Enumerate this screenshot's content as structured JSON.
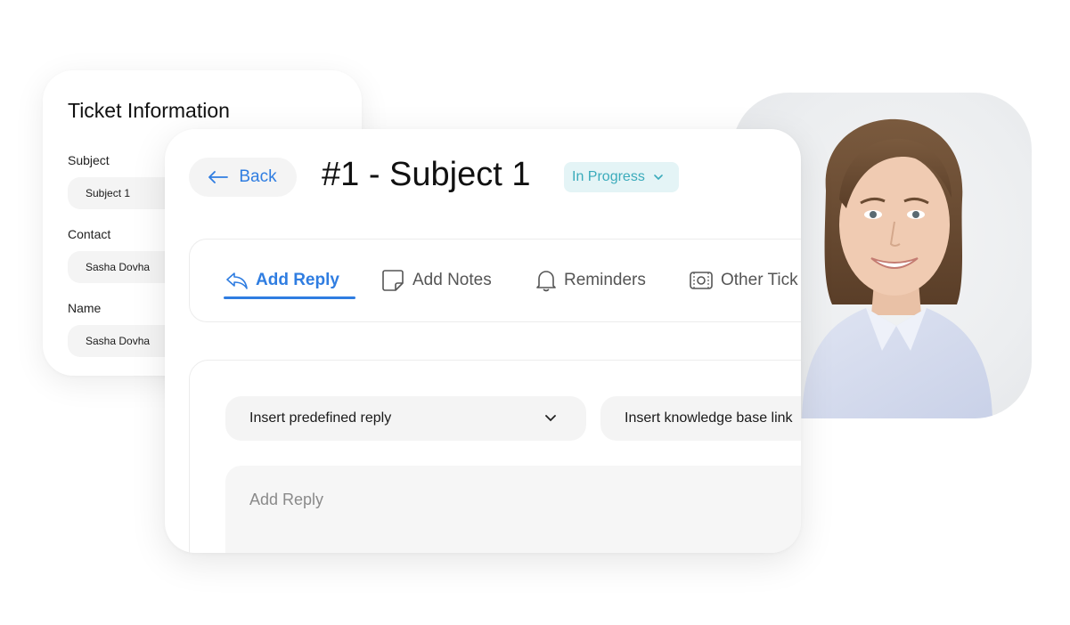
{
  "ticket_info": {
    "title": "Ticket Information",
    "fields": [
      {
        "label": "Subject",
        "value": "Subject 1"
      },
      {
        "label": "Contact",
        "value": "Sasha Dovha"
      },
      {
        "label": "Name",
        "value": "Sasha Dovha"
      }
    ]
  },
  "header": {
    "back_label": "Back",
    "ticket_title": "#1 - Subject 1",
    "status": "In Progress"
  },
  "tabs": [
    {
      "label": "Add Reply",
      "icon": "reply-icon",
      "active": true
    },
    {
      "label": "Add Notes",
      "icon": "note-icon",
      "active": false
    },
    {
      "label": "Reminders",
      "icon": "bell-icon",
      "active": false
    },
    {
      "label": "Other Tick",
      "icon": "tickets-icon",
      "active": false
    }
  ],
  "reply": {
    "predefined_reply": "Insert predefined reply",
    "knowledge_base": "Insert knowledge base link",
    "placeholder": "Add Reply"
  },
  "colors": {
    "accent": "#2f7de1",
    "status_bg": "#e4f4f6",
    "status_text": "#3aabbb"
  },
  "photo": {
    "icon": "contact-photo"
  }
}
